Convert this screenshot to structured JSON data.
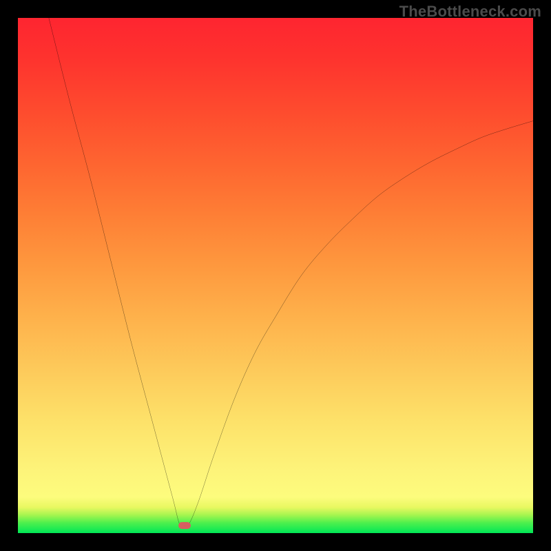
{
  "watermark": "TheBottleneck.com",
  "chart_data": {
    "type": "line",
    "title": "",
    "xlabel": "",
    "ylabel": "",
    "xlim": [
      0,
      100
    ],
    "ylim": [
      0,
      100
    ],
    "grid": false,
    "series": [
      {
        "name": "bottleneck-curve",
        "color": "#000000",
        "x": [
          6,
          10,
          14,
          18,
          22,
          26,
          30,
          31.5,
          33,
          35,
          38,
          42,
          46,
          50,
          55,
          60,
          65,
          70,
          75,
          80,
          85,
          90,
          95,
          100
        ],
        "y": [
          100,
          84,
          69,
          53,
          37,
          22,
          7,
          1.5,
          1.5,
          6,
          15,
          26,
          35,
          42,
          50,
          56,
          61,
          65.5,
          69,
          72,
          74.5,
          76.8,
          78.5,
          80
        ]
      }
    ],
    "marker": {
      "name": "optimal-point",
      "color": "#d66060",
      "x": 32.3,
      "y": 1.5
    },
    "background": {
      "type": "vertical-gradient",
      "stops": [
        {
          "pos": 0,
          "color": "#fe2530"
        },
        {
          "pos": 50,
          "color": "#fec052"
        },
        {
          "pos": 93,
          "color": "#fdfc7d"
        },
        {
          "pos": 100,
          "color": "#00e756"
        }
      ]
    }
  }
}
